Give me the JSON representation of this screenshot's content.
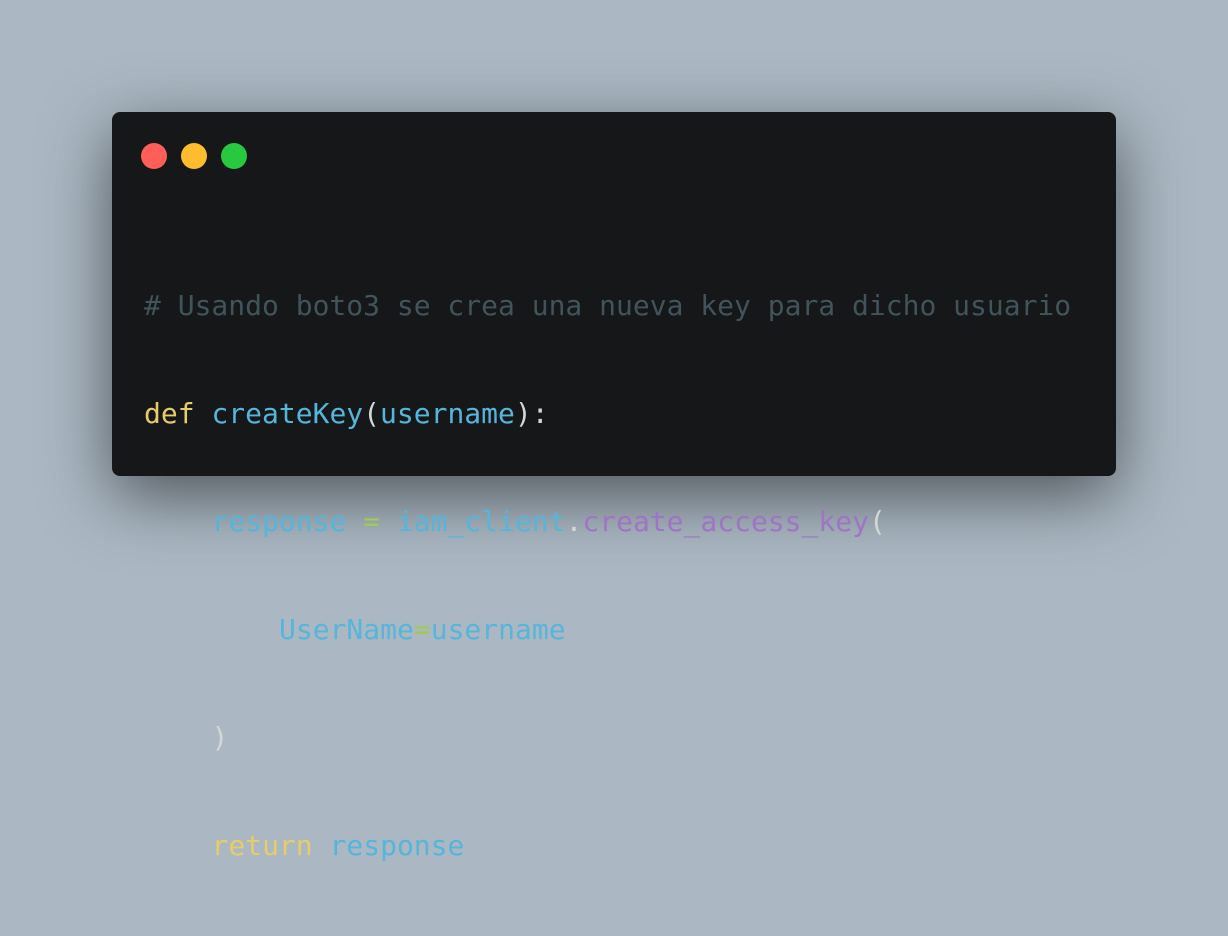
{
  "colors": {
    "background": "#abb8c3",
    "window_background": "#151718",
    "dot_red": "#ff5f56",
    "dot_yellow": "#ffbd2e",
    "dot_green": "#27c93f",
    "comment": "#41535b",
    "keyword": "#e6cd69",
    "identifier": "#55b5db",
    "punctuation": "#d4d7d6",
    "operator": "#9fca56",
    "method": "#a074c4"
  },
  "window_controls": {
    "close_icon": "red-dot-icon",
    "minimize_icon": "yellow-dot-icon",
    "maximize_icon": "green-dot-icon"
  },
  "code": {
    "line1": {
      "comment": "# Usando boto3 se crea una nueva key para dicho usuario"
    },
    "line2": {
      "keyword": "def",
      "function_name": "createKey",
      "open_paren": "(",
      "param": "username",
      "close": "):"
    },
    "line3": {
      "variable": "response",
      "assign": "=",
      "object": "iam_client",
      "dot": ".",
      "method": "create_access_key",
      "open_paren": "("
    },
    "line4": {
      "kwarg": "UserName",
      "equals": "=",
      "value": "username"
    },
    "line5": {
      "close_paren": ")"
    },
    "line6": {
      "keyword": "return",
      "value": "response"
    }
  }
}
